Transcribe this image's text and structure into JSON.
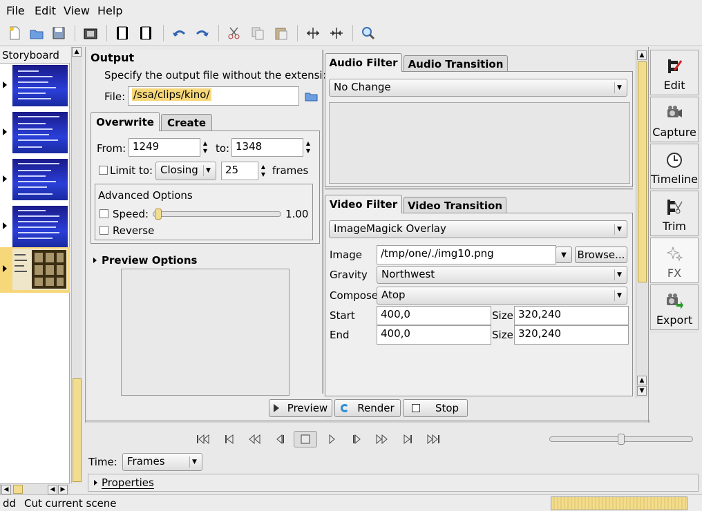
{
  "menu": {
    "file": "File",
    "edit": "Edit",
    "view": "View",
    "help": "Help"
  },
  "toolbar_icons": [
    "new-icon",
    "open-icon",
    "save-icon",
    "save-frame-icon",
    "insert-before-icon",
    "insert-after-icon",
    "undo-icon",
    "redo-icon",
    "cut-icon",
    "copy-icon",
    "paste-icon",
    "split-icon",
    "join-icon",
    "zoom-icon"
  ],
  "storyboard": {
    "title": "Storyboard",
    "scene_count": 5,
    "selected_scene": 5
  },
  "output": {
    "title": "Output",
    "hint": "Specify the output file without the extension",
    "file_label": "File:",
    "file_value": "/ssa/clips/kino/"
  },
  "tabs": {
    "overwrite": "Overwrite",
    "create": "Create"
  },
  "range": {
    "from_label": "From:",
    "from_value": "1249",
    "to_label": "to:",
    "to_value": "1348",
    "limit_label": "Limit to:",
    "limit_mode": "Closing",
    "limit_value": "25",
    "frames_label": "frames"
  },
  "advanced": {
    "title": "Advanced Options",
    "speed_label": "Speed:",
    "speed_value": "1.00",
    "reverse_label": "Reverse"
  },
  "preview_options": {
    "title": "Preview Options"
  },
  "audio": {
    "tab_filter": "Audio Filter",
    "tab_transition": "Audio Transition",
    "filter_value": "No Change"
  },
  "video": {
    "tab_filter": "Video Filter",
    "tab_transition": "Video Transition",
    "filter_value": "ImageMagick Overlay",
    "image_label": "Image",
    "image_value": "/tmp/one/./img10.png",
    "browse_label": "Browse...",
    "gravity_label": "Gravity",
    "gravity_value": "Northwest",
    "compose_label": "Compose",
    "compose_value": "Atop",
    "start_label": "Start",
    "start_value": "400,0",
    "start_size_label": "Size",
    "start_size_value": "320,240",
    "end_label": "End",
    "end_value": "400,0",
    "end_size_label": "Size",
    "end_size_value": "320,240"
  },
  "actions": {
    "preview": "Preview",
    "render": "Render",
    "stop": "Stop"
  },
  "sidebar": [
    {
      "label": "Edit",
      "icon": "edit-icon"
    },
    {
      "label": "Capture",
      "icon": "capture-icon"
    },
    {
      "label": "Timeline",
      "icon": "timeline-icon"
    },
    {
      "label": "Trim",
      "icon": "trim-icon"
    },
    {
      "label": "FX",
      "icon": "fx-icon"
    },
    {
      "label": "Export",
      "icon": "export-icon"
    }
  ],
  "transport": {
    "time_label": "Time:",
    "time_mode": "Frames",
    "properties_label": "Properties",
    "slider_fraction": 0.5
  },
  "status": {
    "prefix": "dd",
    "message": "Cut current scene"
  },
  "colors": {
    "accent_yellow": "#f6d77a",
    "highlight_text_bg": "#f6d77a",
    "panel_bg": "#ececec",
    "thumb_blue": "#2a3fd8"
  }
}
